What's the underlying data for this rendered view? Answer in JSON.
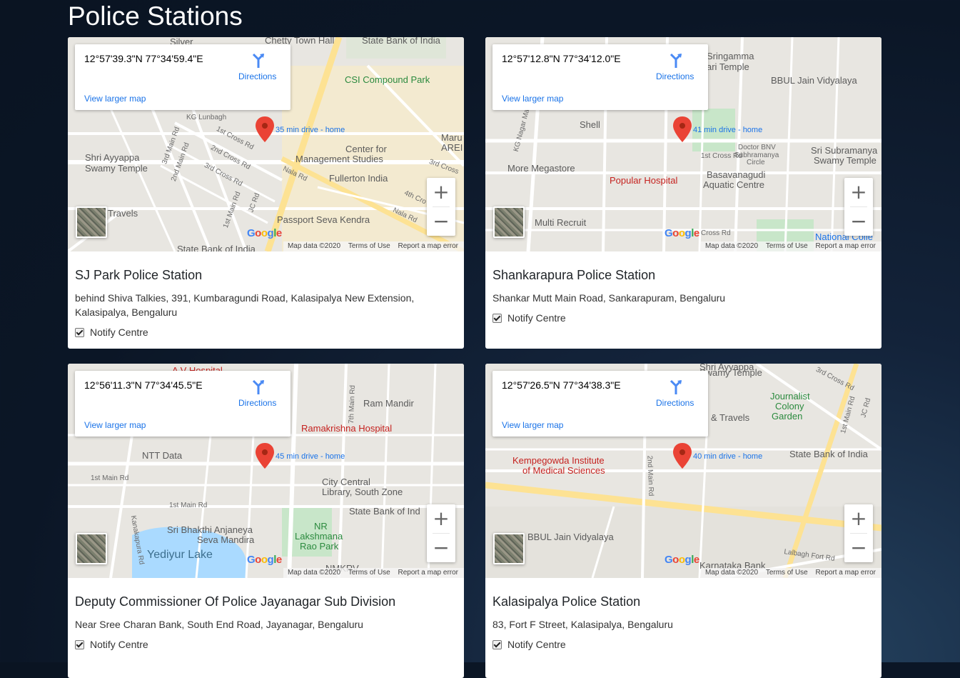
{
  "page": {
    "title": "Police Stations"
  },
  "map_common": {
    "directions_label": "Directions",
    "larger_map_label": "View larger map",
    "zoom_in": "+",
    "zoom_out": "−",
    "google": "Google",
    "map_data": "Map data ©2020",
    "terms": "Terms of Use",
    "report": "Report a map error",
    "notify_label": "Notify Centre"
  },
  "stations": [
    {
      "name": "SJ Park Police Station",
      "address": "behind Shiva Talkies, 391, Kumbaragundi Road, Kalasipalya New Extension, Kalasipalya, Bengaluru",
      "coords": "12°57'39.3\"N 77°34'59.4\"E",
      "drive": "35 min drive - home",
      "notify_checked": true,
      "map_labels": [
        "Silver",
        "Chetty Town Hall",
        "State Bank of India",
        "CSI Compound Park",
        "Shri Ayyappa",
        "Swamy Temple",
        "Center for",
        "Management Studies",
        "Fullerton India",
        "Passport Seva Kendra",
        "Travels",
        "State Bank of India",
        "KG Lunbagh",
        "1st Cross Rd",
        "2nd Cross Rd",
        "3rd Cross Rd",
        "3rd Main Rd",
        "2nd Main Rd",
        "1st Main Rd",
        "JC Rd",
        "Nala Rd",
        "4th Cro",
        "Nala Rd",
        "Maru",
        "AREI",
        "3rd Cross"
      ]
    },
    {
      "name": "Shankarapura Police Station",
      "address": "Shankar Mutt Main Road, Sankarapuram, Bengaluru",
      "coords": "12°57'12.8\"N 77°34'12.0\"E",
      "drive": "41 min drive - home",
      "notify_checked": true,
      "map_labels": [
        "Sringamma",
        "ari Temple",
        "BBUL Jain Vidyalaya",
        "Shell",
        "More Megastore",
        "Popular Hospital",
        "Basavanagudi",
        "Aquatic Centre",
        "Sri Subramanya",
        "Swamy Temple",
        "Doctor BNV",
        "Subhramanya",
        "Circle",
        "Multi Recruit",
        "National Colle",
        "KG Nagar Main",
        "1st Cross Rd",
        "Cross Rd"
      ]
    },
    {
      "name": "Deputy Commissioner Of Police Jayanagar Sub Division",
      "address": "Near Sree Charan Bank, South End Road, Jayanagar, Bengaluru",
      "coords": "12°56'11.3\"N 77°34'45.5\"E",
      "drive": "45 min drive - home",
      "notify_checked": true,
      "map_labels": [
        "A V Hospital",
        "Ram Mandir",
        "Ramakrishna Hospital",
        "NTT Data",
        "City Central",
        "Library, South Zone",
        "State Bank of Ind",
        "NR",
        "Lakshmana",
        "Rao Park",
        "Sri Bhakthi Anjaneya",
        "Seva Mandira",
        "Yediyur Lake",
        "NMKRV",
        "1st Main Rd",
        "1st Main Rd",
        "7th Main Rd",
        "Kanakapura Rd"
      ]
    },
    {
      "name": "Kalasipalya Police Station",
      "address": "83, Fort F Street, Kalasipalya, Bengaluru",
      "coords": "12°57'26.5\"N 77°34'38.3\"E",
      "drive": "40 min drive - home",
      "notify_checked": true,
      "map_labels": [
        "Shri Ayyappa",
        "Swamy Temple",
        "Journalist",
        "Colony",
        "Garden",
        "& Travels",
        "State Bank of India",
        "Kempegowda Institute",
        "of Medical Sciences",
        "BBUL Jain Vidyalaya",
        "Karnataka Bank",
        "Lalbagh Fort Rd",
        "2nd Main Rd",
        "3rd Cross Rd",
        "JC Rd",
        "1st Main Rd"
      ]
    }
  ]
}
